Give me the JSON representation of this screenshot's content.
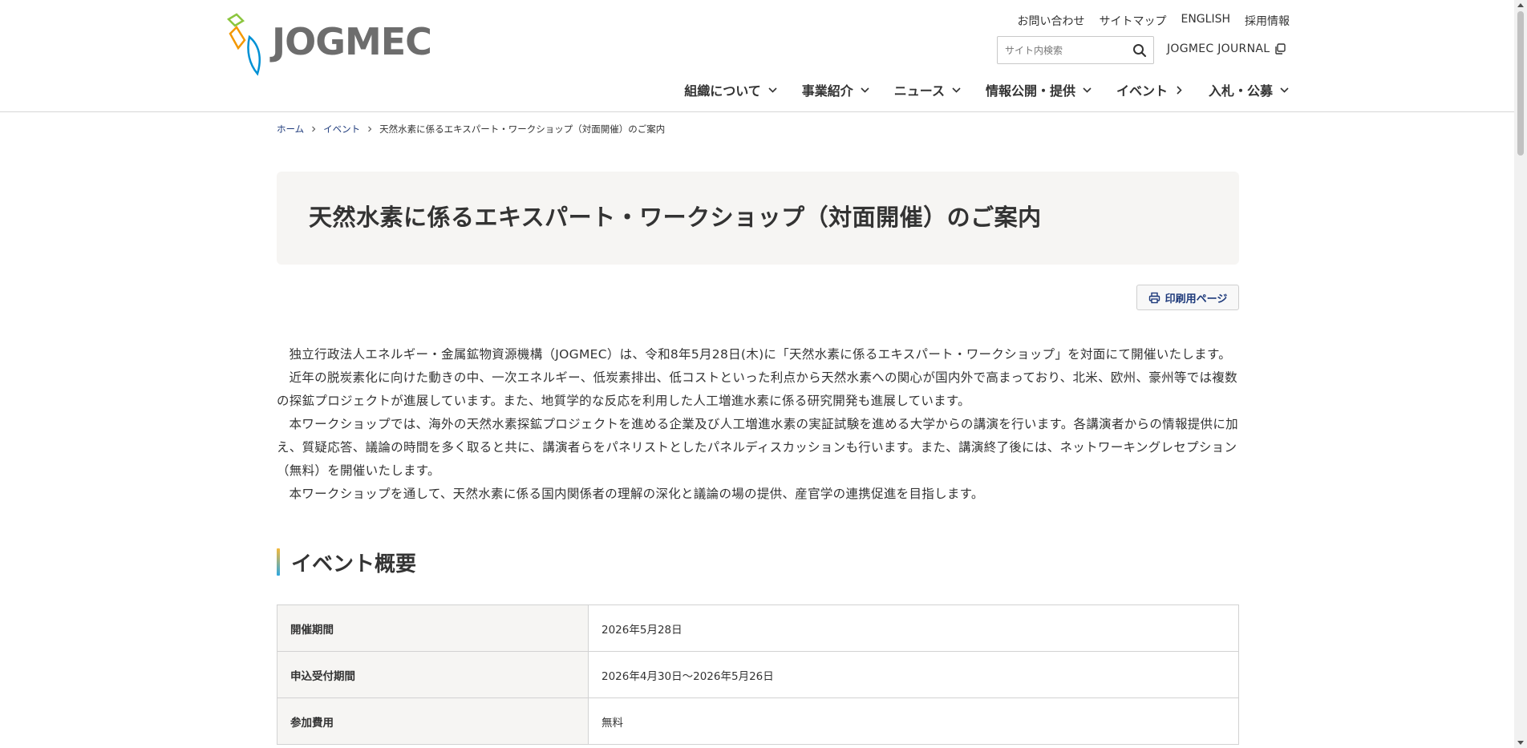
{
  "header": {
    "logo_text": "JOGMEC",
    "util_links": [
      "お問い合わせ",
      "サイトマップ",
      "ENGLISH",
      "採用情報"
    ],
    "search": {
      "placeholder": "サイト内検索",
      "value": ""
    },
    "journal_label": "JOGMEC JOURNAL",
    "nav": [
      {
        "label": "組織について",
        "icon": "chevron-down-icon"
      },
      {
        "label": "事業紹介",
        "icon": "chevron-down-icon"
      },
      {
        "label": "ニュース",
        "icon": "chevron-down-icon"
      },
      {
        "label": "情報公開・提供",
        "icon": "chevron-down-icon"
      },
      {
        "label": "イベント",
        "icon": "chevron-right-icon"
      },
      {
        "label": "入札・公募",
        "icon": "chevron-down-icon"
      }
    ]
  },
  "breadcrumb": {
    "home": "ホーム",
    "event": "イベント",
    "current": "天然水素に係るエキスパート・ワークショップ（対面開催）のご案内"
  },
  "page": {
    "title": "天然水素に係るエキスパート・ワークショップ（対面開催）のご案内",
    "print_label": "印刷用ページ",
    "paragraphs": [
      "独立行政法人エネルギー・金属鉱物資源機構（JOGMEC）は、令和8年5月28日(木)に「天然水素に係るエキスパート・ワークショップ」を対面にて開催いたします。",
      "近年の脱炭素化に向けた動きの中、一次エネルギー、低炭素排出、低コストといった利点から天然水素への関心が国内外で高まっており、北米、欧州、豪州等では複数の探鉱プロジェクトが進展しています。また、地質学的な反応を利用した人工増進水素に係る研究開発も進展しています。",
      "本ワークショップでは、海外の天然水素探鉱プロジェクトを進める企業及び人工増進水素の実証試験を進める大学からの講演を行います。各講演者からの情報提供に加え、質疑応答、議論の時間を多く取ると共に、講演者らをパネリストとしたパネルディスカッションも行います。また、講演終了後には、ネットワーキングレセプション（無料）を開催いたします。",
      "本ワークショップを通して、天然水素に係る国内関係者の理解の深化と議論の場の提供、産官学の連携促進を目指します。"
    ],
    "section_title": "イベント概要",
    "table": [
      {
        "label": "開催期間",
        "value": "2026年5月28日"
      },
      {
        "label": "申込受付期間",
        "value": "2026年4月30日～2026年5月26日"
      },
      {
        "label": "参加費用",
        "value": "無料"
      }
    ]
  },
  "colors": {
    "link": "#1e3a7b",
    "title_bg": "#f6f5f3",
    "logo_gray": "#6d6d6d",
    "logo_green": "#8cc63f",
    "logo_orange": "#f39800",
    "logo_blue": "#0091d5"
  }
}
